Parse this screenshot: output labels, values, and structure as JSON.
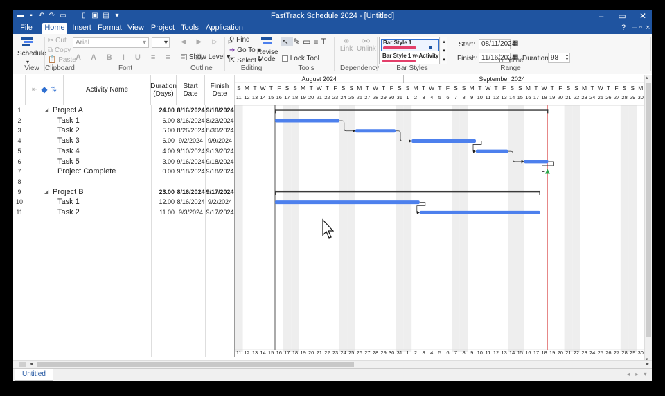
{
  "window": {
    "title": "FastTrack Schedule 2024 - [Untitled]"
  },
  "menu_tabs": [
    "File",
    "Home",
    "Insert",
    "Format",
    "View",
    "Project",
    "Tools",
    "Application"
  ],
  "active_tab": "Home",
  "ribbon": {
    "schedule": "Schedule",
    "view": "View",
    "cut": "Cut",
    "copy": "Copy",
    "paste": "Paste",
    "clipboard": "Clipboard",
    "font_name": "Arial",
    "font": "Font",
    "show_level": "Show Level",
    "outline": "Outline",
    "find": "Find",
    "goto": "Go To",
    "select": "Select",
    "revise_mode": "Revise Mode",
    "editing": "Editing",
    "lock_tool": "Lock Tool",
    "tools": "Tools",
    "link": "Link",
    "unlink": "Unlink",
    "dependency": "Dependency",
    "bar_style_1": "Bar Style 1",
    "bar_style_2": "Bar Style 1 w-Activity I",
    "bar_styles": "Bar Styles",
    "start_label": "Start:",
    "start_value": "08/11/2024",
    "finish_label": "Finish:",
    "finish_value": "11/16/2024",
    "duration_label": "Duration:",
    "duration_value": "98",
    "timeline_range": "Timeline Range"
  },
  "columns": {
    "activity": "Activity Name",
    "duration": "Duration (Days)",
    "start": "Start Date",
    "finish": "Finish Date"
  },
  "rows": [
    {
      "n": "1",
      "name": "Project A",
      "dur": "24.00",
      "start": "8/16/2024",
      "finish": "9/18/2024",
      "type": "summary"
    },
    {
      "n": "2",
      "name": "Task 1",
      "dur": "6.00",
      "start": "8/16/2024",
      "finish": "8/23/2024",
      "type": "task"
    },
    {
      "n": "3",
      "name": "Task 2",
      "dur": "5.00",
      "start": "8/26/2024",
      "finish": "8/30/2024",
      "type": "task"
    },
    {
      "n": "4",
      "name": "Task 3",
      "dur": "6.00",
      "start": "9/2/2024",
      "finish": "9/9/2024",
      "type": "task"
    },
    {
      "n": "5",
      "name": "Task 4",
      "dur": "4.00",
      "start": "9/10/2024",
      "finish": "9/13/2024",
      "type": "task"
    },
    {
      "n": "6",
      "name": "Task 5",
      "dur": "3.00",
      "start": "9/16/2024",
      "finish": "9/18/2024",
      "type": "task"
    },
    {
      "n": "7",
      "name": "Project Complete",
      "dur": "0.00",
      "start": "9/18/2024",
      "finish": "9/18/2024",
      "type": "milestone"
    },
    {
      "n": "8",
      "name": "",
      "dur": "",
      "start": "",
      "finish": "",
      "type": "blank"
    },
    {
      "n": "9",
      "name": "Project B",
      "dur": "23.00",
      "start": "8/16/2024",
      "finish": "9/17/2024",
      "type": "summary"
    },
    {
      "n": "10",
      "name": "Task 1",
      "dur": "12.00",
      "start": "8/16/2024",
      "finish": "9/2/2024",
      "type": "task"
    },
    {
      "n": "11",
      "name": "Task 2",
      "dur": "11.00",
      "start": "9/3/2024",
      "finish": "9/17/2024",
      "type": "task"
    }
  ],
  "timeline": {
    "months": [
      "August 2024",
      "September 2024"
    ],
    "days": [
      {
        "d": "11",
        "w": "S"
      },
      {
        "d": "12",
        "w": "M"
      },
      {
        "d": "13",
        "w": "T"
      },
      {
        "d": "14",
        "w": "W"
      },
      {
        "d": "15",
        "w": "T"
      },
      {
        "d": "16",
        "w": "F"
      },
      {
        "d": "17",
        "w": "S"
      },
      {
        "d": "18",
        "w": "S"
      },
      {
        "d": "19",
        "w": "M"
      },
      {
        "d": "20",
        "w": "T"
      },
      {
        "d": "21",
        "w": "W"
      },
      {
        "d": "22",
        "w": "T"
      },
      {
        "d": "23",
        "w": "F"
      },
      {
        "d": "24",
        "w": "S"
      },
      {
        "d": "25",
        "w": "S"
      },
      {
        "d": "26",
        "w": "M"
      },
      {
        "d": "27",
        "w": "T"
      },
      {
        "d": "28",
        "w": "W"
      },
      {
        "d": "29",
        "w": "T"
      },
      {
        "d": "30",
        "w": "F"
      },
      {
        "d": "31",
        "w": "S"
      },
      {
        "d": "1",
        "w": "S"
      },
      {
        "d": "2",
        "w": "M"
      },
      {
        "d": "3",
        "w": "T"
      },
      {
        "d": "4",
        "w": "W"
      },
      {
        "d": "5",
        "w": "T"
      },
      {
        "d": "6",
        "w": "F"
      },
      {
        "d": "7",
        "w": "S"
      },
      {
        "d": "8",
        "w": "S"
      },
      {
        "d": "9",
        "w": "M"
      },
      {
        "d": "10",
        "w": "T"
      },
      {
        "d": "11",
        "w": "W"
      },
      {
        "d": "12",
        "w": "T"
      },
      {
        "d": "13",
        "w": "F"
      },
      {
        "d": "14",
        "w": "S"
      },
      {
        "d": "15",
        "w": "S"
      },
      {
        "d": "16",
        "w": "M"
      },
      {
        "d": "17",
        "w": "T"
      },
      {
        "d": "18",
        "w": "W"
      },
      {
        "d": "19",
        "w": "T"
      },
      {
        "d": "20",
        "w": "F"
      },
      {
        "d": "21",
        "w": "S"
      },
      {
        "d": "22",
        "w": "S"
      },
      {
        "d": "23",
        "w": "M"
      },
      {
        "d": "24",
        "w": "T"
      },
      {
        "d": "25",
        "w": "W"
      },
      {
        "d": "26",
        "w": "T"
      },
      {
        "d": "27",
        "w": "F"
      },
      {
        "d": "28",
        "w": "S"
      },
      {
        "d": "29",
        "w": "S"
      },
      {
        "d": "30",
        "w": "M"
      }
    ]
  },
  "bars": [
    {
      "row": 0,
      "kind": "summary",
      "start": "2024-08-16",
      "end": "2024-09-18"
    },
    {
      "row": 1,
      "kind": "task",
      "start": "2024-08-16",
      "end": "2024-08-23"
    },
    {
      "row": 2,
      "kind": "task",
      "start": "2024-08-26",
      "end": "2024-08-30"
    },
    {
      "row": 3,
      "kind": "task",
      "start": "2024-09-02",
      "end": "2024-09-09"
    },
    {
      "row": 4,
      "kind": "task",
      "start": "2024-09-10",
      "end": "2024-09-13"
    },
    {
      "row": 5,
      "kind": "task",
      "start": "2024-09-16",
      "end": "2024-09-18"
    },
    {
      "row": 6,
      "kind": "milestone",
      "start": "2024-09-18",
      "end": "2024-09-18"
    },
    {
      "row": 8,
      "kind": "summary",
      "start": "2024-08-16",
      "end": "2024-09-17"
    },
    {
      "row": 9,
      "kind": "task",
      "start": "2024-08-16",
      "end": "2024-09-02"
    },
    {
      "row": 10,
      "kind": "task",
      "start": "2024-09-03",
      "end": "2024-09-17"
    }
  ],
  "colors": {
    "accent": "#1f54a0",
    "task_bar": "#4d80ed",
    "summary_bar": "#3a3a3a",
    "milestone": "#2aa84a",
    "today_line": "#e06a6a",
    "weekend": "#eeeeee"
  },
  "sheet_tab": "Untitled"
}
